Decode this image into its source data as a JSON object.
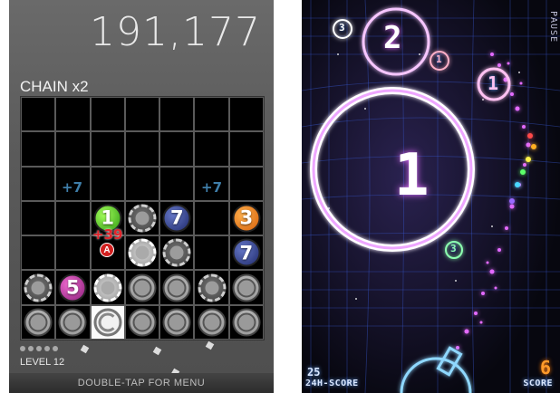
{
  "left_game": {
    "score": "191,177",
    "chain": "CHAIN x2",
    "level": "LEVEL 12",
    "menu_hint": "DOUBLE-TAP FOR MENU",
    "popups": {
      "plus7_a": "+7",
      "plus7_b": "+7",
      "plus39": "+39",
      "badge": "A"
    },
    "level_dots": 5,
    "grid": [
      [
        "",
        "",
        "",
        "",
        "",
        "",
        ""
      ],
      [
        "",
        "",
        "",
        "",
        "",
        "",
        ""
      ],
      [
        "",
        "",
        "",
        "",
        "",
        "",
        ""
      ],
      [
        "",
        "",
        "1|green",
        "crack",
        "7|navy",
        "",
        "3|orange"
      ],
      [
        "",
        "",
        "",
        "crack-w",
        "crack",
        "",
        "7|navy"
      ],
      [
        "crack",
        "5|purple",
        "crack-w",
        "grey",
        "grey",
        "crack",
        "grey"
      ],
      [
        "grey",
        "grey",
        "clear",
        "grey",
        "grey",
        "grey",
        "grey"
      ]
    ]
  },
  "right_game": {
    "pause": "PAUSE",
    "best_value": "25",
    "best_label": "24H-SCORE",
    "score_value": "6",
    "score_label": "SCORE",
    "big_circle": "1",
    "mid_circle": "2",
    "small_circles": [
      "3",
      "1",
      "1",
      "3"
    ],
    "colors": {
      "neon_purple": "#e36bff",
      "grid_blue": "#3a5bd8",
      "score_orange": "#ff9a2a"
    }
  }
}
